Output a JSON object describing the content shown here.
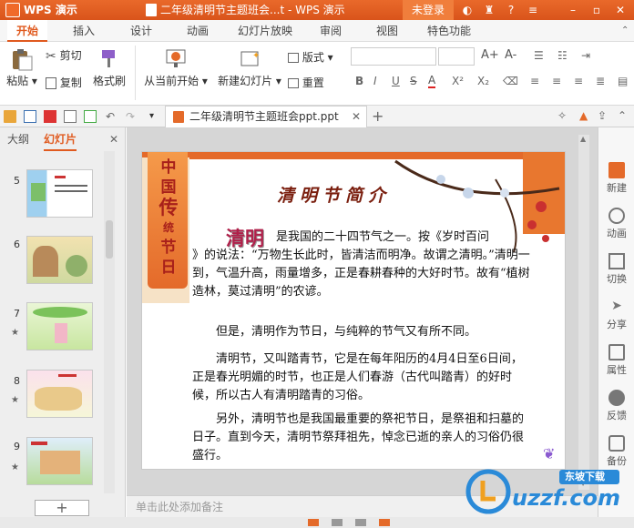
{
  "titlebar": {
    "app_name": "WPS 演示",
    "window_title": "二年级清明节主题班会...t - WPS 演示",
    "login_label": "未登录"
  },
  "menu": {
    "items": [
      "开始",
      "插入",
      "设计",
      "动画",
      "幻灯片放映",
      "审阅",
      "视图",
      "特色功能"
    ],
    "active": "开始"
  },
  "ribbon": {
    "paste": "粘贴",
    "cut": "剪切",
    "copy": "复制",
    "format_painter": "格式刷",
    "from_current": "从当前开始",
    "new_slide": "新建幻灯片",
    "layout": "版式",
    "reset": "重置",
    "font_bold": "B",
    "font_italic": "I",
    "font_underline": "U",
    "font_strike": "S",
    "font_color": "A",
    "superscript": "X²",
    "subscript": "X₂",
    "grow": "A+",
    "shrink": "A-"
  },
  "doc_tab": {
    "label": "二年级清明节主题班会ppt.ppt"
  },
  "left_panel": {
    "tab_outline": "大纲",
    "tab_slides": "幻灯片",
    "close": "✕",
    "slides": [
      {
        "num": "5",
        "star": false
      },
      {
        "num": "6",
        "star": false
      },
      {
        "num": "7",
        "star": true
      },
      {
        "num": "8",
        "star": true
      },
      {
        "num": "9",
        "star": true
      }
    ],
    "add_label": "+"
  },
  "slide": {
    "banner": [
      "中",
      "国",
      "传",
      "统",
      "节",
      "日"
    ],
    "title": "清明节简介",
    "keyword": "清明",
    "p1_first": "是我国的二十四节气之一。按《岁时百问",
    "p1_rest": "》的说法：“万物生长此时，皆清洁而明净。故谓之清明。”清明一到，气温升高，雨量增多，正是春耕春种的大好时节。故有“植树造林，莫过清明”的农谚。",
    "p2": "但是，清明作为节日，与纯粹的节气又有所不同。",
    "p3": "清明节，又叫踏青节，它是在每年阳历的4月4日至6日间，正是春光明媚的时节，也正是人们春游（古代叫踏青）的好时候，所以古人有清明踏青的习俗。",
    "p4": "另外，清明节也是我国最重要的祭祀节日，是祭祖和扫墓的日子。直到今天，清明节祭拜祖先，悼念已逝的亲人的习俗仍很盛行。"
  },
  "notes_placeholder": "单击此处添加备注",
  "right_panel": [
    "新建",
    "动画",
    "切换",
    "分享",
    "属性",
    "反馈",
    "备份"
  ],
  "watermark": {
    "text": "uzzf.com",
    "sub": "东坡下载"
  },
  "colors": {
    "accent": "#e05a1f",
    "title": "#7a1e0e",
    "keyword": "#b0204a"
  }
}
